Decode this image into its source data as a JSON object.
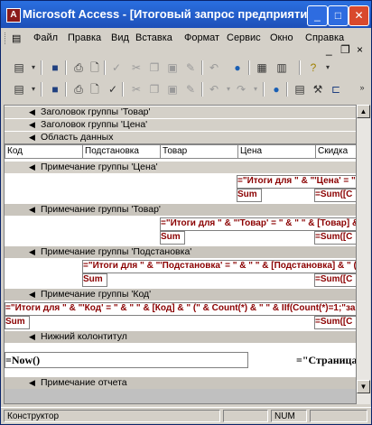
{
  "window": {
    "title": "Microsoft Access - [Итоговый запрос предприятия : о...",
    "minimize": "_",
    "maximize": "□",
    "close": "✕",
    "app_icon": "A"
  },
  "menu": {
    "items": [
      "Файл",
      "Правка",
      "Вид",
      "Вставка",
      "Формат",
      "Сервис",
      "Окно",
      "Справка"
    ],
    "mdi_min": "_",
    "mdi_restore": "❐",
    "mdi_close": "×"
  },
  "report": {
    "bands": {
      "group_header_tovar": "Заголовок группы 'Товар'",
      "group_header_cena": "Заголовок группы 'Цена'",
      "detail": "Область данных",
      "group_footer_cena": "Примечание группы 'Цена'",
      "group_footer_tovar": "Примечание группы 'Товар'",
      "group_footer_podstanovka": "Примечание группы 'Подстановка'",
      "group_footer_kod": "Примечание группы 'Код'",
      "page_footer": "Нижний колонтитул",
      "report_footer": "Примечание отчета"
    },
    "detail_fields": [
      "Код",
      "Подстановка",
      "Товар",
      "Цена",
      "Скидка"
    ],
    "cena_footer": {
      "expr": "=\"Итоги для \" & \"'Цена' = \" & \" \" & [Цена",
      "sum_label": "Sum",
      "sum_expr": "=Sum([С"
    },
    "tovar_footer": {
      "expr": "=\"Итоги для \" & \"'Товар' = \" & \" \" & [Товар] & \"",
      "sum_label": "Sum",
      "sum_expr": "=Sum([С"
    },
    "podstanovka_footer": {
      "expr": "=\"Итоги для \" & \"'Подстановка' = \" & \" \" & [Подстановка] & \" (",
      "sum_label": "Sum",
      "sum_expr": "=Sum([С"
    },
    "kod_footer": {
      "expr": "=\"Итоги для \" & \"'Код' = \" & \" \" & [Код] & \" (\" & Count(*) & \" \" & IIf(Count(*)=1;\"за",
      "sum_label": "Sum",
      "sum_expr": "=Sum([С"
    },
    "page_footer": {
      "now_expr": "=Now()",
      "page_expr": "=\"Страница"
    }
  },
  "status": {
    "mode": "Конструктор",
    "num": "NUM"
  },
  "icons": {
    "tb1": [
      "view-icon",
      "save-icon",
      "print-icon",
      "print-preview-icon",
      "spell-check-icon",
      "cut-icon",
      "copy-icon",
      "paste-icon",
      "format-painter-icon",
      "undo-icon",
      "web-icon",
      "office-links-icon",
      "analyze-icon",
      "help-icon"
    ],
    "tb2": [
      "view-icon",
      "save-icon",
      "print-icon",
      "print-preview-icon",
      "spell-check-icon",
      "cut-icon",
      "copy-icon",
      "paste-icon",
      "format-painter-icon",
      "undo-icon",
      "redo-icon",
      "web-icon",
      "properties-icon",
      "build-icon",
      "code-icon"
    ]
  }
}
